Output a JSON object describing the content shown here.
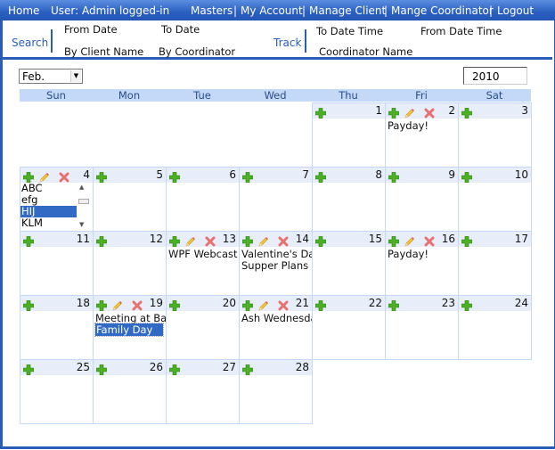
{
  "topbar": {
    "home": "Home",
    "user": "User: Admin logged-in",
    "links": [
      "Masters",
      "My Account",
      "Manage Client",
      "Mange Coordinator",
      "Logout"
    ],
    "separator": "|"
  },
  "subbar": {
    "search": "Search",
    "from_date": "From Date",
    "to_date": "To Date",
    "by_client_name": "By Client Name",
    "by_coordinator": "By Coordinator",
    "track": "Track",
    "to_date_time": "To Date Time",
    "from_date_time": "From Date Time",
    "coordinator_name": "Coordinator Name"
  },
  "calendar": {
    "month": "Feb.",
    "year": "2010",
    "days_of_week": [
      "Sun",
      "Mon",
      "Tue",
      "Wed",
      "Thu",
      "Fri",
      "Sat"
    ],
    "listbox_items": [
      "ABC",
      "efg",
      "HIJ",
      "KLM"
    ],
    "listbox_selected": "HIJ",
    "days": [
      {
        "day": "1",
        "events": []
      },
      {
        "day": "2",
        "events": [
          "Payday!"
        ]
      },
      {
        "day": "3",
        "events": []
      },
      {
        "day": "4",
        "events": []
      },
      {
        "day": "5",
        "events": []
      },
      {
        "day": "6",
        "events": []
      },
      {
        "day": "7",
        "events": []
      },
      {
        "day": "8",
        "events": []
      },
      {
        "day": "9",
        "events": []
      },
      {
        "day": "10",
        "events": []
      },
      {
        "day": "11",
        "events": []
      },
      {
        "day": "12",
        "events": []
      },
      {
        "day": "13",
        "events": [
          "WPF Webcast"
        ]
      },
      {
        "day": "14",
        "events": [
          "Valentine's Day",
          "Supper Plans"
        ]
      },
      {
        "day": "15",
        "events": []
      },
      {
        "day": "16",
        "events": [
          "Payday!"
        ]
      },
      {
        "day": "17",
        "events": []
      },
      {
        "day": "18",
        "events": []
      },
      {
        "day": "19",
        "events": [
          "Meeting at Bank",
          "Family Day"
        ]
      },
      {
        "day": "20",
        "events": []
      },
      {
        "day": "21",
        "events": [
          "Ash Wednesday"
        ]
      },
      {
        "day": "22",
        "events": []
      },
      {
        "day": "23",
        "events": []
      },
      {
        "day": "24",
        "events": []
      },
      {
        "day": "25",
        "events": []
      },
      {
        "day": "26",
        "events": []
      },
      {
        "day": "27",
        "events": []
      },
      {
        "day": "28",
        "events": []
      }
    ],
    "selected_event": "Family Day",
    "editable_days": [
      "2",
      "4",
      "13",
      "14",
      "16",
      "19",
      "21"
    ]
  },
  "icons": {
    "add": "add-icon",
    "edit": "pencil-icon",
    "delete": "delete-icon"
  },
  "colors": {
    "accent": "#2a5db8",
    "header_bg": "#c4d9f7",
    "cell_header_bg": "#e7eef9",
    "selection": "#316ac5"
  }
}
